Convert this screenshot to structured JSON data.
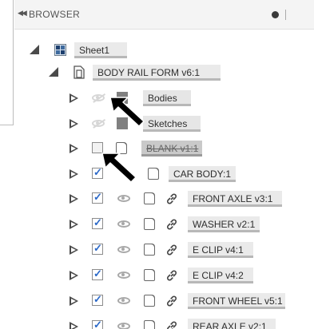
{
  "browser": {
    "title": "BROWSER",
    "collapse_icon": "double-chevron-left-icon",
    "pin_icon": "filled-circle-icon"
  },
  "tree": {
    "sheet": {
      "label": "Sheet1",
      "icon": "sheet-component-icon"
    },
    "component": {
      "label": "BODY RAIL FORM v6:1",
      "icon": "component-icon"
    },
    "folders": [
      {
        "label": "Bodies",
        "visible": false
      },
      {
        "label": "Sketches",
        "visible": false
      }
    ],
    "blank": {
      "label": "BLANK v1:1",
      "checked": false
    },
    "car_body": {
      "label": "CAR BODY:1",
      "checked": true
    },
    "occurrences": [
      {
        "label": "FRONT AXLE v3:1",
        "checked": true,
        "linked": true
      },
      {
        "label": "WASHER v2:1",
        "checked": true,
        "linked": true
      },
      {
        "label": "E CLIP v4:1",
        "checked": true,
        "linked": true
      },
      {
        "label": "E CLIP v4:2",
        "checked": true,
        "linked": true
      },
      {
        "label": "FRONT WHEEL v5:1",
        "checked": true,
        "linked": true
      },
      {
        "label": "REAR AXLE v2:1",
        "checked": true,
        "linked": true
      }
    ]
  },
  "colors": {
    "checkmark": "#2a68c8",
    "annotation_arrow": "#000000",
    "header_bg": "#f4f4f4"
  }
}
